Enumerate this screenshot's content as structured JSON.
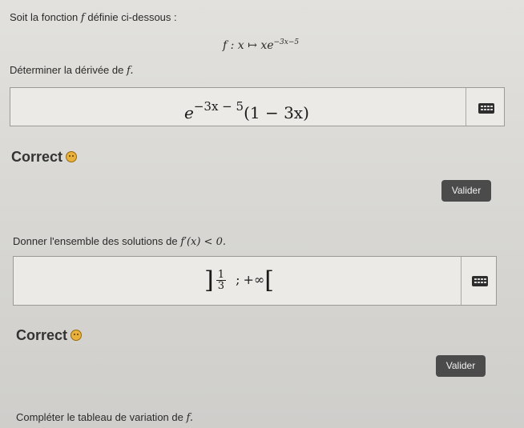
{
  "q1": {
    "intro": "Soit la fonction",
    "func_letter": "f",
    "intro_tail": "définie ci-dessous :",
    "def_prefix": "f : x ↦ xe",
    "def_exp": "−3x−5",
    "prompt_prefix": "Déterminer la dérivée de",
    "prompt_var": "f.",
    "answer_base": "e",
    "answer_exp": "−3x − 5",
    "answer_tail": "(1 − 3x)",
    "feedback": "Correct",
    "submit_label": "Valider"
  },
  "q2": {
    "prompt_prefix": "Donner l'ensemble des solutions de",
    "prompt_math": "f′(x) < 0.",
    "answer_open": "]",
    "answer_num": "1",
    "answer_den": "3",
    "answer_sep": ";",
    "answer_inf": "+∞",
    "answer_close": "[",
    "feedback": "Correct",
    "submit_label": "Valider"
  },
  "q3": {
    "prompt_prefix": "Compléter le tableau de variation de",
    "prompt_var": "f."
  },
  "icons": {
    "keyboard": "keyboard-icon",
    "smiley": "smiley-icon"
  },
  "colors": {
    "button_bg": "#4b4b4b",
    "smiley": "#e7b13c"
  }
}
